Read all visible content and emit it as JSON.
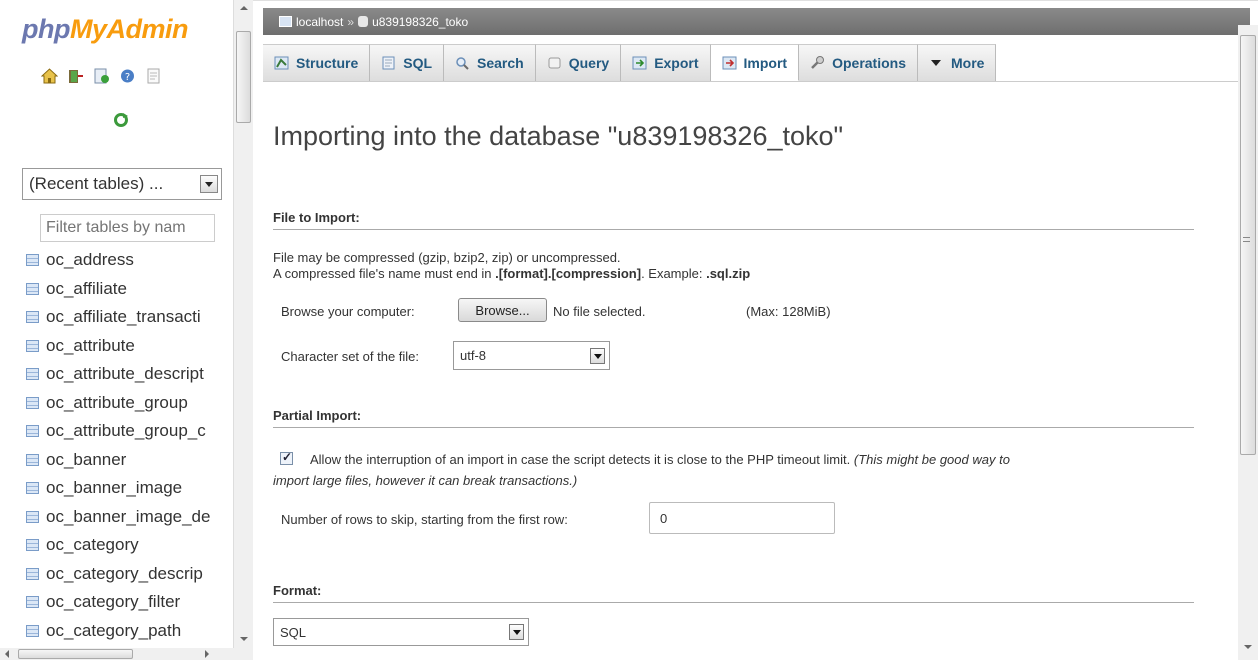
{
  "logo": {
    "part1": "php",
    "part2": "MyAdmin"
  },
  "nav_icons": [
    "home-icon",
    "exit-icon",
    "sql-query-icon",
    "help-icon",
    "docs-icon"
  ],
  "recent_tables": {
    "label": "(Recent tables) ..."
  },
  "filter": {
    "placeholder": "Filter tables by nam"
  },
  "tables": [
    "oc_address",
    "oc_affiliate",
    "oc_affiliate_transacti",
    "oc_attribute",
    "oc_attribute_descript",
    "oc_attribute_group",
    "oc_attribute_group_c",
    "oc_banner",
    "oc_banner_image",
    "oc_banner_image_de",
    "oc_category",
    "oc_category_descrip",
    "oc_category_filter",
    "oc_category_path"
  ],
  "breadcrumb": {
    "server": "localhost",
    "separator": "»",
    "database": "u839198326_toko"
  },
  "tabs": [
    {
      "label": "Structure",
      "icon": "structure-icon"
    },
    {
      "label": "SQL",
      "icon": "sql-icon"
    },
    {
      "label": "Search",
      "icon": "search-icon"
    },
    {
      "label": "Query",
      "icon": "query-icon"
    },
    {
      "label": "Export",
      "icon": "export-icon"
    },
    {
      "label": "Import",
      "icon": "import-icon",
      "active": true
    },
    {
      "label": "Operations",
      "icon": "operations-icon"
    },
    {
      "label": "More",
      "icon": "dropdown-icon"
    }
  ],
  "page": {
    "heading": "Importing into the database \"u839198326_toko\"",
    "file_section": {
      "title": "File to Import:",
      "line1": "File may be compressed (gzip, bzip2, zip) or uncompressed.",
      "line2_prefix": "A compressed file's name must end in ",
      "line2_bold": ".[format].[compression]",
      "line2_mid": ". Example: ",
      "line2_example": ".sql.zip",
      "browse_label": "Browse your computer:",
      "browse_button": "Browse...",
      "no_file": "No file selected.",
      "max_size": "(Max: 128MiB)",
      "charset_label": "Character set of the file:",
      "charset_value": "utf-8"
    },
    "partial_section": {
      "title": "Partial Import:",
      "allow_text": "Allow the interruption of an import in case the script detects it is close to the PHP timeout limit.",
      "allow_note_1": "(This might be good way to",
      "allow_note_2": "import large files, however it can break transactions.)",
      "allow_checked": true,
      "skip_label": "Number of rows to skip, starting from the first row:",
      "skip_value": "0"
    },
    "format_section": {
      "title": "Format:",
      "value": "SQL"
    }
  },
  "colors": {
    "logo_php": "#6c78af",
    "logo_myadmin": "#f89c0e",
    "tab_text": "#235a81",
    "breadcrumb_bg": "#7c7c7c"
  }
}
